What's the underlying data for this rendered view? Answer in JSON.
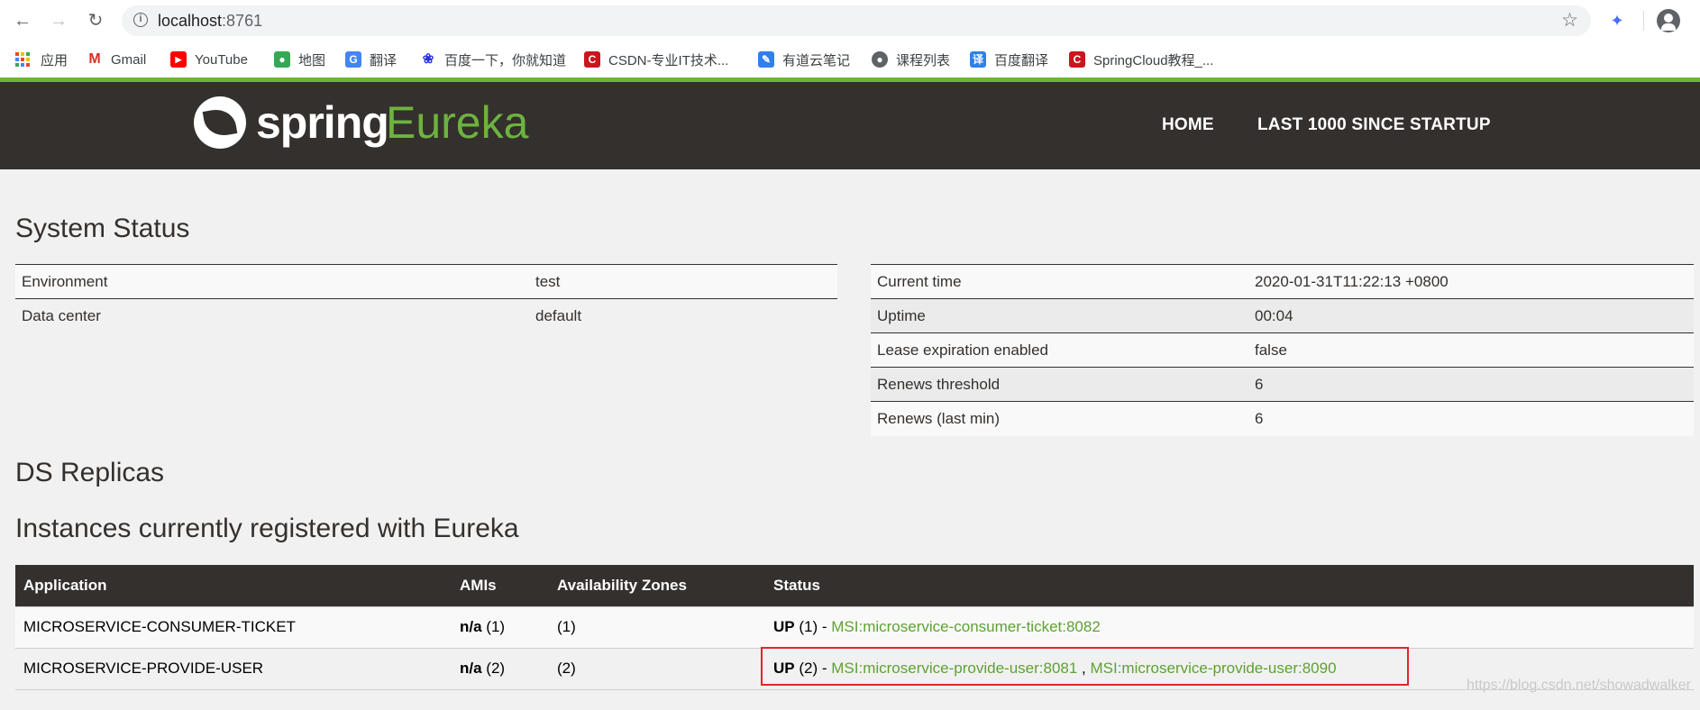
{
  "browser": {
    "url_host": "localhost",
    "url_port": ":8761",
    "bookmarks": [
      {
        "label": "应用",
        "icon": "apps-icon"
      },
      {
        "label": "Gmail",
        "icon": "gmail-icon",
        "color": "#d93025"
      },
      {
        "label": "YouTube",
        "icon": "youtube-icon",
        "color": "#ff0000"
      },
      {
        "label": "地图",
        "icon": "maps-icon",
        "color": "#34a853"
      },
      {
        "label": "翻译",
        "icon": "translate-icon",
        "color": "#4285f4"
      },
      {
        "label": "百度一下，你就知道",
        "icon": "baidu-icon",
        "color": "#2932e1"
      },
      {
        "label": "CSDN-专业IT技术...",
        "icon": "csdn-icon",
        "color": "#c9171e"
      },
      {
        "label": "有道云笔记",
        "icon": "youdao-note-icon",
        "color": "#2f80ed"
      },
      {
        "label": "课程列表",
        "icon": "globe-icon",
        "color": "#5f6368"
      },
      {
        "label": "百度翻译",
        "icon": "baidu-translate-icon",
        "color": "#2f80ed"
      },
      {
        "label": "SpringCloud教程_...",
        "icon": "csdn-icon",
        "color": "#c9171e"
      }
    ]
  },
  "navbar": {
    "brand_spring": "spring",
    "brand_eureka": "Eureka",
    "home": "HOME",
    "last1000": "LAST 1000 SINCE STARTUP"
  },
  "system_status": {
    "title": "System Status",
    "left": [
      {
        "key": "Environment",
        "value": "test"
      },
      {
        "key": "Data center",
        "value": "default"
      }
    ],
    "right": [
      {
        "key": "Current time",
        "value": "2020-01-31T11:22:13 +0800"
      },
      {
        "key": "Uptime",
        "value": "00:04"
      },
      {
        "key": "Lease expiration enabled",
        "value": "false"
      },
      {
        "key": "Renews threshold",
        "value": "6"
      },
      {
        "key": "Renews (last min)",
        "value": "6"
      }
    ]
  },
  "ds_replicas": {
    "title": "DS Replicas"
  },
  "instances": {
    "title": "Instances currently registered with Eureka",
    "headers": [
      "Application",
      "AMIs",
      "Availability Zones",
      "Status"
    ],
    "rows": [
      {
        "application": "MICROSERVICE-CONSUMER-TICKET",
        "amis_na": "n/a",
        "amis_count": "(1)",
        "zones": "(1)",
        "status_up": "UP",
        "status_count": "(1) -",
        "links": [
          "MSI:microservice-consumer-ticket:8082"
        ]
      },
      {
        "application": "MICROSERVICE-PROVIDE-USER",
        "amis_na": "n/a",
        "amis_count": "(2)",
        "zones": "(2)",
        "status_up": "UP",
        "status_count": "(2) -",
        "links": [
          "MSI:microservice-provide-user:8081",
          "MSI:microservice-provide-user:8090"
        ]
      }
    ]
  },
  "watermark": "https://blog.csdn.net/showadwalker"
}
